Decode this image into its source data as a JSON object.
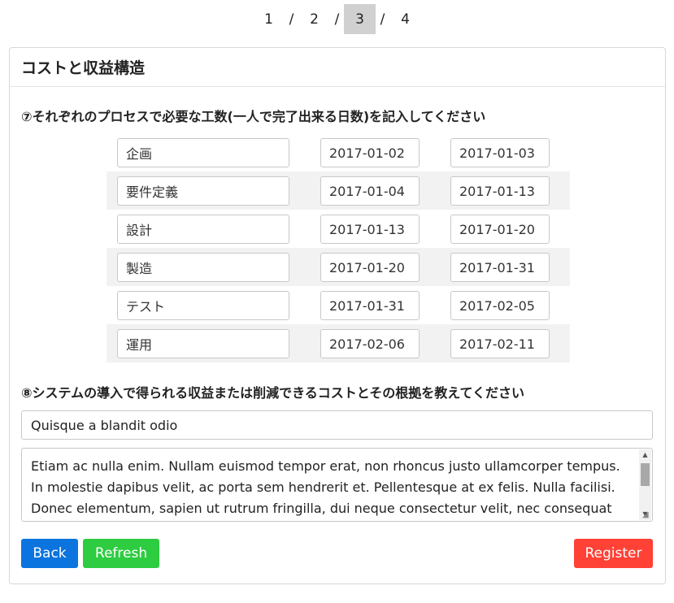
{
  "pager": {
    "pages": [
      "1",
      "2",
      "3",
      "4"
    ],
    "separator": "/",
    "current_index": 2
  },
  "section": {
    "title": "コストと収益構造"
  },
  "question7": {
    "label": "⑦それぞれのプロセスで必要な工数(一人で完了出来る日数)を記入してください",
    "rows": [
      {
        "name": "企画",
        "start": "2017-01-02",
        "end": "2017-01-03"
      },
      {
        "name": "要件定義",
        "start": "2017-01-04",
        "end": "2017-01-13"
      },
      {
        "name": "設計",
        "start": "2017-01-13",
        "end": "2017-01-20"
      },
      {
        "name": "製造",
        "start": "2017-01-20",
        "end": "2017-01-31"
      },
      {
        "name": "テスト",
        "start": "2017-01-31",
        "end": "2017-02-05"
      },
      {
        "name": "運用",
        "start": "2017-02-06",
        "end": "2017-02-11"
      }
    ]
  },
  "question8": {
    "label": "⑧システムの導入で得られる収益または削減できるコストとその根拠を教えてください",
    "title_value": "Quisque a blandit odio",
    "body_value": "Etiam ac nulla enim. Nullam euismod tempor erat, non rhoncus justo ullamcorper tempus. In molestie dapibus velit, ac porta sem hendrerit et. Pellentesque at ex felis. Nulla facilisi. Donec elementum, sapien ut rutrum fringilla, dui neque consectetur velit, nec consequat massa velit"
  },
  "buttons": {
    "back": "Back",
    "refresh": "Refresh",
    "register": "Register"
  },
  "colors": {
    "back": "#0b74de",
    "refresh": "#2ecc40",
    "register": "#ff4136",
    "pager_active": "#d0d0d0"
  },
  "icons": {
    "scroll_up": "triangle-up",
    "scroll_down": "triangle-down",
    "resize": "resize-grip"
  }
}
